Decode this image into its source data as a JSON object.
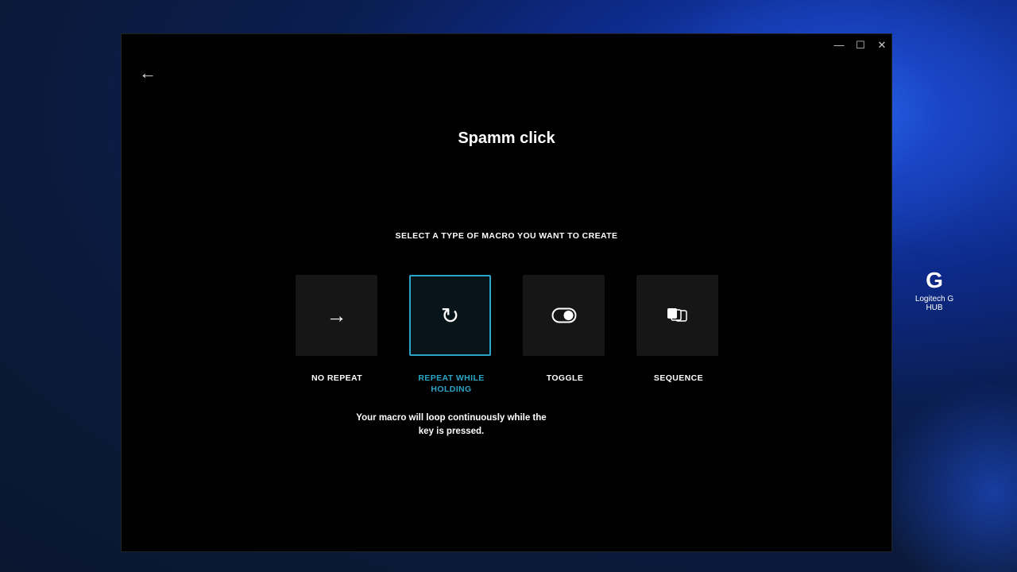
{
  "window": {
    "minimize": "—",
    "maximize": "☐",
    "close": "✕",
    "back": "←"
  },
  "title": "Spamm click",
  "subtitle": "SELECT A TYPE OF MACRO YOU WANT TO CREATE",
  "options": [
    {
      "label": "NO REPEAT",
      "icon": "→",
      "selected": false
    },
    {
      "label": "REPEAT WHILE HOLDING",
      "icon": "↻",
      "selected": true
    },
    {
      "label": "TOGGLE",
      "icon": "toggle",
      "selected": false
    },
    {
      "label": "SEQUENCE",
      "icon": "sequence",
      "selected": false
    }
  ],
  "description": "Your macro will loop continuously while the key is pressed.",
  "desktop_icon": {
    "label": "Logitech G HUB",
    "glyph": "G"
  },
  "accent": "#2aa5c8"
}
